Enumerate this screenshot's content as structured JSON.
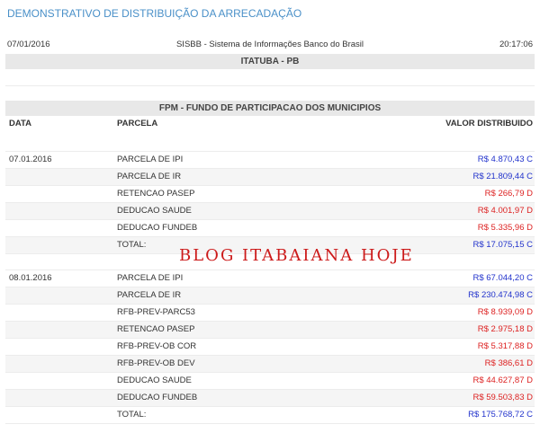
{
  "header": {
    "title": "DEMONSTRATIVO DE DISTRIBUIÇÃO DA ARRECADAÇÃO",
    "date": "07/01/2016",
    "system": "SISBB - Sistema de Informações Banco do Brasil",
    "time": "20:17:06",
    "municipality": "ITATUBA - PB"
  },
  "fund": {
    "title": "FPM - FUNDO DE PARTICIPACAO DOS MUNICIPIOS",
    "col_date": "DATA",
    "col_parcel": "PARCELA",
    "col_value": "VALOR DISTRIBUIDO"
  },
  "groups": [
    {
      "date": "07.01.2016",
      "rows": [
        {
          "parcel": "PARCELA DE IPI",
          "value": "R$ 4.870,43 C",
          "type": "C"
        },
        {
          "parcel": "PARCELA DE IR",
          "value": "R$ 21.809,44 C",
          "type": "C"
        },
        {
          "parcel": "RETENCAO PASEP",
          "value": "R$ 266,79 D",
          "type": "D"
        },
        {
          "parcel": "DEDUCAO SAUDE",
          "value": "R$ 4.001,97 D",
          "type": "D"
        },
        {
          "parcel": "DEDUCAO FUNDEB",
          "value": "R$ 5.335,96 D",
          "type": "D"
        },
        {
          "parcel": "TOTAL:",
          "value": "R$ 17.075,15 C",
          "type": "C"
        }
      ]
    },
    {
      "date": "08.01.2016",
      "rows": [
        {
          "parcel": "PARCELA DE IPI",
          "value": "R$ 67.044,20 C",
          "type": "C"
        },
        {
          "parcel": "PARCELA DE IR",
          "value": "R$ 230.474,98 C",
          "type": "C"
        },
        {
          "parcel": "RFB-PREV-PARC53",
          "value": "R$ 8.939,09 D",
          "type": "D"
        },
        {
          "parcel": "RETENCAO PASEP",
          "value": "R$ 2.975,18 D",
          "type": "D"
        },
        {
          "parcel": "RFB-PREV-OB COR",
          "value": "R$ 5.317,88 D",
          "type": "D"
        },
        {
          "parcel": "RFB-PREV-OB DEV",
          "value": "R$ 386,61 D",
          "type": "D"
        },
        {
          "parcel": "DEDUCAO SAUDE",
          "value": "R$ 44.627,87 D",
          "type": "D"
        },
        {
          "parcel": "DEDUCAO FUNDEB",
          "value": "R$ 59.503,83 D",
          "type": "D"
        },
        {
          "parcel": "TOTAL:",
          "value": "R$ 175.768,72 C",
          "type": "C"
        }
      ]
    }
  ],
  "watermark": "BLOG ITABAIANA HOJE",
  "colors": {
    "credit": "#2233cc",
    "debit": "#dd2222",
    "title": "#4a90c8"
  }
}
